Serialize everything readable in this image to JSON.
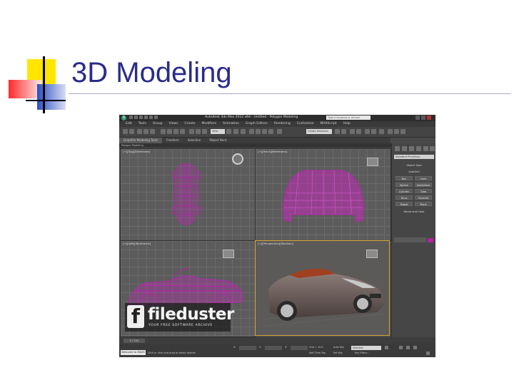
{
  "slide": {
    "title": "3D Modeling",
    "accent_colors": {
      "yellow": "#ffe600",
      "red": "#ff3c3c",
      "blue": "#3255c6",
      "title": "#2b2b8a"
    }
  },
  "app": {
    "window_caption": "Autodesk 3ds Max 2012 x64 - Untitled - Polygon Modeling",
    "search_placeholder": "Type a keyword or phrase",
    "menu": [
      "Edit",
      "Tools",
      "Group",
      "Views",
      "Create",
      "Modifiers",
      "Animation",
      "Graph Editors",
      "Rendering",
      "Customize",
      "MAXScript",
      "Help"
    ],
    "toolbar_view_select": "View",
    "toolbar_named_selection": "Create Selection Se",
    "ribbon_tabs": [
      "Graphite Modeling Tools",
      "Freeform",
      "Selection",
      "Object Paint"
    ],
    "ribbon_sub": "Polygon Modeling",
    "viewports": {
      "top": "[+][Top][Wireframe]",
      "front": "[+][Front][Wireframe]",
      "left": "[+][Left][Wireframe]",
      "perspective": "[+][Perspective][Realistic]"
    },
    "command_panel": {
      "dropdown": "Standard Primitives",
      "object_type": "Object Type",
      "autogrid": "AutoGrid",
      "buttons": [
        "Box",
        "Cone",
        "Sphere",
        "GeoSphere",
        "Cylinder",
        "Tube",
        "Torus",
        "Pyramid",
        "Teapot",
        "Plane"
      ],
      "name_color": "Name and Color",
      "object_color": "#b51fa8"
    },
    "timeline": {
      "frame_counter": "0 / 100"
    },
    "status": {
      "welcome": "Welcome to MAXS",
      "message": "Click or click-and-drag to select objects",
      "x_label": "X:",
      "y_label": "Y:",
      "z_label": "Z:",
      "grid": "Grid = 10.0",
      "auto_key": "Auto Key",
      "selected": "Selected",
      "set_key": "Set Key",
      "key_filters": "Key Filters...",
      "add_time_tag": "Add Time Tag"
    }
  },
  "watermark": {
    "letter": "f",
    "name": "fileduster",
    "tagline": "YOUR FREE SOFTWARE ARCHIVE"
  }
}
